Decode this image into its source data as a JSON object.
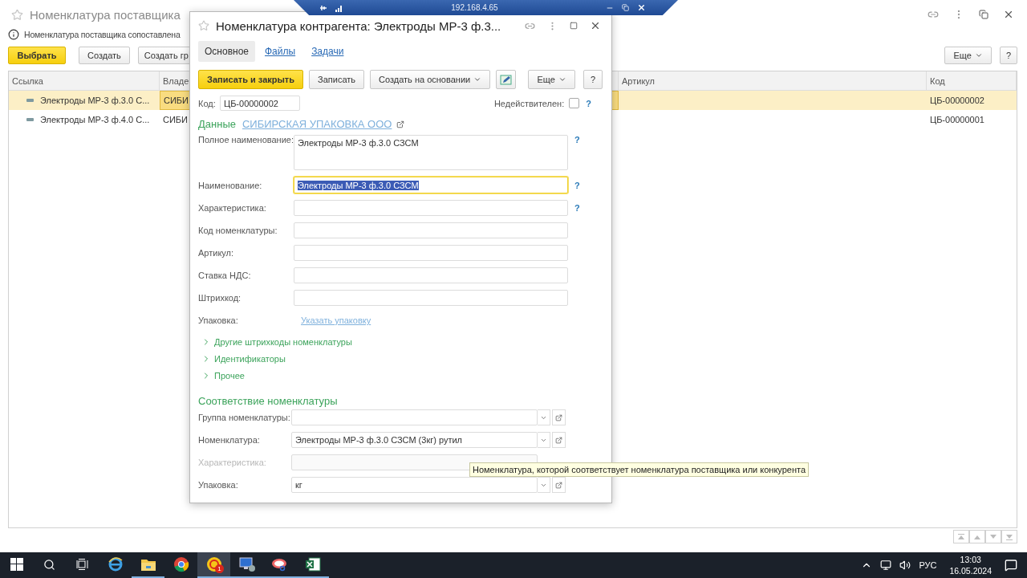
{
  "remote_bar": {
    "address": "192.168.4.65"
  },
  "list_window": {
    "title": "Номенклатура поставщика",
    "info": "Номенклатура поставщика сопоставлена",
    "buttons": [
      {
        "label": "Выбрать",
        "kind": "primary"
      },
      {
        "label": "Создать",
        "kind": "plain"
      },
      {
        "label": "Создать гр",
        "kind": "plain"
      }
    ],
    "more": "Еще",
    "help": "?",
    "columns": [
      "Ссылка",
      "Владе",
      "Артикул",
      "Код"
    ],
    "rows": [
      {
        "selected": true,
        "link": "Электроды МР-3 ф.3.0 С...",
        "owner": "СИБИ",
        "code": "ЦБ-00000002"
      },
      {
        "selected": false,
        "link": "Электроды МР-3 ф.4.0 С...",
        "owner": "СИБИ",
        "code": "ЦБ-00000001"
      }
    ]
  },
  "dialog": {
    "title": "Номенклатура контрагента: Электроды МР-3 ф.3...",
    "tabs": [
      {
        "label": "Основное",
        "selected": true
      },
      {
        "label": "Файлы",
        "selected": false
      },
      {
        "label": "Задачи",
        "selected": false
      }
    ],
    "toolbar": [
      {
        "kind": "primary",
        "label": "Записать и закрыть"
      },
      {
        "kind": "plain",
        "label": "Записать"
      },
      {
        "kind": "menu",
        "label": "Создать на основании"
      },
      {
        "kind": "icon"
      }
    ],
    "more": "Еще",
    "help": "?",
    "code": {
      "label": "Код:",
      "value": "ЦБ-00000002"
    },
    "inactive": {
      "label": "Недействителен:",
      "checked": false,
      "help": "?"
    },
    "data_section": {
      "title": "Данные",
      "owner_link": "СИБИРСКАЯ УПАКОВКА ООО"
    },
    "fields": [
      {
        "kind": "textarea",
        "label": "Полное наименование:",
        "value": "Электроды МР-3 ф.3.0 СЗСМ",
        "focused": false,
        "help": "?"
      },
      {
        "kind": "input",
        "label": "Наименование:",
        "value": "Электроды МР-3 ф.3.0 СЗСМ",
        "focused": true,
        "help": "?"
      },
      {
        "kind": "input",
        "label": "Характеристика:",
        "focused": false,
        "help": "?"
      },
      {
        "kind": "input",
        "label": "Код номенклатуры:",
        "focused": false
      },
      {
        "kind": "input",
        "label": "Артикул:",
        "focused": false
      },
      {
        "kind": "input",
        "label": "Ставка НДС:",
        "focused": false
      },
      {
        "kind": "input",
        "label": "Штрихкод:",
        "focused": false
      },
      {
        "kind": "link",
        "label": "Упаковка:",
        "link": "Указать упаковку"
      }
    ],
    "groups": [
      {
        "label": "Другие штрихкоды номенклатуры",
        "expanded": false
      },
      {
        "label": "Идентификаторы",
        "expanded": false
      },
      {
        "label": "Прочее",
        "expanded": false
      }
    ],
    "match_section": {
      "title": "Соответствие номенклатуры",
      "fields": [
        {
          "label": "Группа номенклатуры:",
          "disabled": false
        },
        {
          "label": "Номенклатура:",
          "value": "Электроды МР-3 ф.3.0 СЗСМ (3кг) рутил",
          "disabled": false
        },
        {
          "label": "Характеристика:",
          "disabled": true
        },
        {
          "label": "Упаковка:",
          "value": "кг",
          "disabled": false
        }
      ]
    }
  },
  "tooltip": "Номенклатура, которой соответствует номенклатура поставщика или конкурента",
  "taskbar": {
    "apps": [
      {
        "kind": "browser-e",
        "running": false,
        "selected": false
      },
      {
        "kind": "folder",
        "running": true,
        "selected": false
      },
      {
        "kind": "chrome",
        "running": false,
        "selected": false
      },
      {
        "kind": "onec",
        "running": true,
        "selected": true,
        "badge": "1"
      },
      {
        "kind": "remote",
        "running": true,
        "selected": false
      },
      {
        "kind": "snip",
        "running": true,
        "selected": false
      },
      {
        "kind": "sheet",
        "running": true,
        "selected": false
      }
    ],
    "language": "РУС",
    "time": "13:03",
    "date": "16.05.2024"
  }
}
